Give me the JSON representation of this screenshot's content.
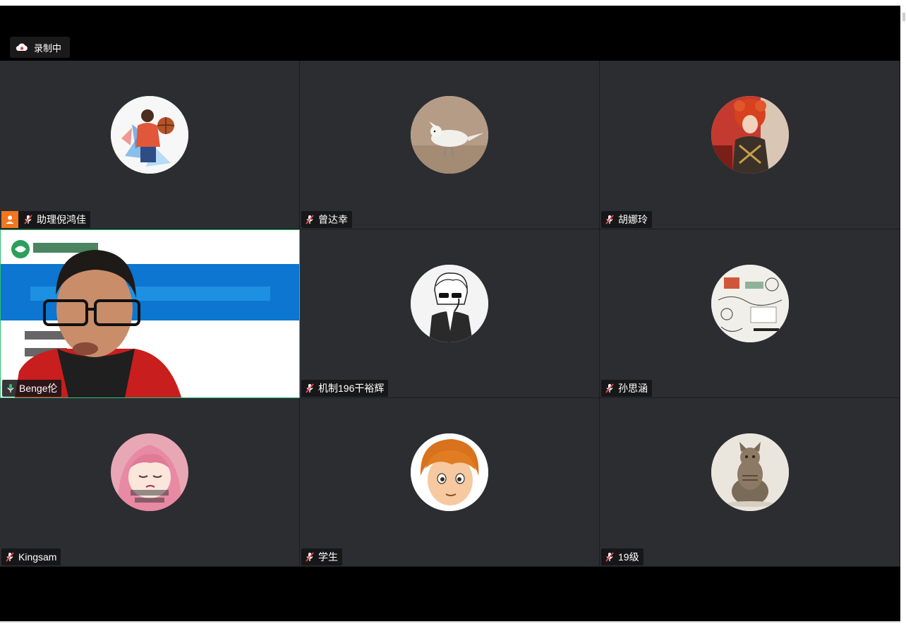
{
  "recording": {
    "label": "录制中"
  },
  "participants": [
    {
      "name": "助理倪鸿佳",
      "muted": true,
      "host": true,
      "avatar": "basketball-player-avatar"
    },
    {
      "name": "曾达幸",
      "muted": true,
      "host": false,
      "avatar": "white-parrot-avatar"
    },
    {
      "name": "胡娜玲",
      "muted": true,
      "host": false,
      "avatar": "red-hat-girl-avatar"
    },
    {
      "name": "Benge伦",
      "muted": false,
      "host": false,
      "avatar": "camera-video",
      "active": true
    },
    {
      "name": "机制196干裕辉",
      "muted": true,
      "host": false,
      "avatar": "sunglasses-cartoon-avatar"
    },
    {
      "name": "孙思涵",
      "muted": true,
      "host": false,
      "avatar": "sketch-notes-avatar"
    },
    {
      "name": "Kingsam",
      "muted": true,
      "host": false,
      "avatar": "anime-pink-hair-avatar"
    },
    {
      "name": "学生",
      "muted": true,
      "host": false,
      "avatar": "cartoon-boy-avatar"
    },
    {
      "name": "19级",
      "muted": true,
      "host": false,
      "avatar": "cat-avatar"
    }
  ],
  "colors": {
    "tile_bg": "#2b2d31",
    "active_border": "#2fbf71",
    "host_badge": "#f0761f",
    "muted_icon": "#e5484d",
    "mic_active": "#2fbf71"
  }
}
